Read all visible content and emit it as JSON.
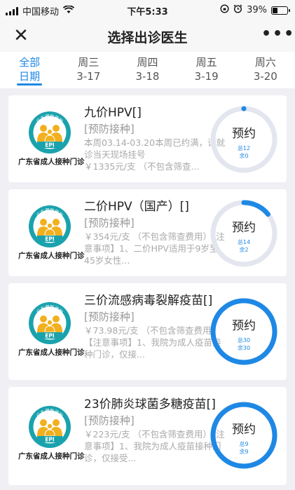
{
  "status": {
    "carrier": "中国移动",
    "time": "下午5:33",
    "battery": "39%",
    "battery_level": 0.39
  },
  "nav": {
    "close": "✕",
    "title": "选择出诊医生",
    "more": "•••"
  },
  "tabs": [
    {
      "line1": "全部",
      "line2": "日期"
    },
    {
      "line1": "周三",
      "line2": "3-17"
    },
    {
      "line1": "周四",
      "line2": "3-18"
    },
    {
      "line1": "周五",
      "line2": "3-19"
    },
    {
      "line1": "周六",
      "line2": "3-20"
    }
  ],
  "logo_caption": "广东省成人接种门诊",
  "logo_text": {
    "arc": "广东预防接种",
    "epi": "EPI"
  },
  "colors": {
    "accent": "#1e88e5",
    "ring_track": "#e3e6ee",
    "logo_teal": "#1aa2ad",
    "logo_yellow": "#f2b01e"
  },
  "cards": [
    {
      "name": "九价HPV[]",
      "tag": "[预防接种]",
      "desc": "本周03.14-03.20本周已约满，请就诊当天现场挂号",
      "desc2": "￥1335元/支 （不包含筛查...",
      "action": "预约",
      "total": "总12",
      "remain": "余0",
      "progress": 0.0
    },
    {
      "name": "二价HPV（国产）[]",
      "tag": "[预防接种]",
      "desc": "￥354元/支 （不包含筛查费用）【注意事项】1、二价HPV适用于9岁至45岁女性...",
      "desc2": "",
      "action": "预约",
      "total": "总14",
      "remain": "余2",
      "progress": 0.143
    },
    {
      "name": "三价流感病毒裂解疫苗[]",
      "tag": "[预防接种]",
      "desc": "￥73.98元/支 （不包含筛查费用）【注意事项】1、我院为成人疫苗接种门诊，仅接...",
      "desc2": "",
      "action": "预约",
      "total": "总30",
      "remain": "余30",
      "progress": 1.0
    },
    {
      "name": "23价肺炎球菌多糖疫苗[]",
      "tag": "[预防接种]",
      "desc": "￥223元/支 （不包含筛查费用）【注意事项】1、我院为成人疫苗接种门诊，仅接受...",
      "desc2": "",
      "action": "预约",
      "total": "总9",
      "remain": "余9",
      "progress": 1.0
    }
  ]
}
